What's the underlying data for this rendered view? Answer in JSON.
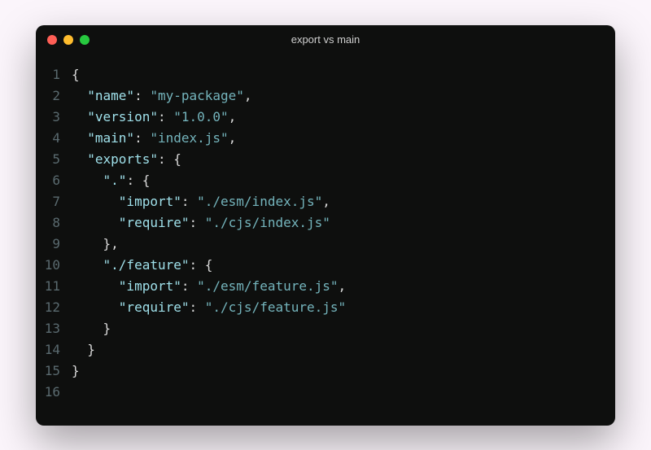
{
  "window": {
    "title": "export vs main"
  },
  "code": {
    "lines": [
      [
        {
          "t": "punc",
          "v": "{"
        }
      ],
      [
        {
          "t": "punc",
          "v": "  "
        },
        {
          "t": "key",
          "v": "\"name\""
        },
        {
          "t": "punc",
          "v": ": "
        },
        {
          "t": "str",
          "v": "\"my-package\""
        },
        {
          "t": "punc",
          "v": ","
        }
      ],
      [
        {
          "t": "punc",
          "v": "  "
        },
        {
          "t": "key",
          "v": "\"version\""
        },
        {
          "t": "punc",
          "v": ": "
        },
        {
          "t": "str",
          "v": "\"1.0.0\""
        },
        {
          "t": "punc",
          "v": ","
        }
      ],
      [
        {
          "t": "punc",
          "v": "  "
        },
        {
          "t": "key",
          "v": "\"main\""
        },
        {
          "t": "punc",
          "v": ": "
        },
        {
          "t": "str",
          "v": "\"index.js\""
        },
        {
          "t": "punc",
          "v": ","
        }
      ],
      [
        {
          "t": "punc",
          "v": "  "
        },
        {
          "t": "key",
          "v": "\"exports\""
        },
        {
          "t": "punc",
          "v": ": {"
        }
      ],
      [
        {
          "t": "punc",
          "v": "    "
        },
        {
          "t": "key",
          "v": "\".\""
        },
        {
          "t": "punc",
          "v": ": {"
        }
      ],
      [
        {
          "t": "punc",
          "v": "      "
        },
        {
          "t": "key",
          "v": "\"import\""
        },
        {
          "t": "punc",
          "v": ": "
        },
        {
          "t": "str",
          "v": "\"./esm/index.js\""
        },
        {
          "t": "punc",
          "v": ","
        }
      ],
      [
        {
          "t": "punc",
          "v": "      "
        },
        {
          "t": "key",
          "v": "\"require\""
        },
        {
          "t": "punc",
          "v": ": "
        },
        {
          "t": "str",
          "v": "\"./cjs/index.js\""
        }
      ],
      [
        {
          "t": "punc",
          "v": "    },"
        }
      ],
      [
        {
          "t": "punc",
          "v": "    "
        },
        {
          "t": "key",
          "v": "\"./feature\""
        },
        {
          "t": "punc",
          "v": ": {"
        }
      ],
      [
        {
          "t": "punc",
          "v": "      "
        },
        {
          "t": "key",
          "v": "\"import\""
        },
        {
          "t": "punc",
          "v": ": "
        },
        {
          "t": "str",
          "v": "\"./esm/feature.js\""
        },
        {
          "t": "punc",
          "v": ","
        }
      ],
      [
        {
          "t": "punc",
          "v": "      "
        },
        {
          "t": "key",
          "v": "\"require\""
        },
        {
          "t": "punc",
          "v": ": "
        },
        {
          "t": "str",
          "v": "\"./cjs/feature.js\""
        }
      ],
      [
        {
          "t": "punc",
          "v": "    }"
        }
      ],
      [
        {
          "t": "punc",
          "v": "  }"
        }
      ],
      [
        {
          "t": "punc",
          "v": "}"
        }
      ],
      []
    ]
  }
}
